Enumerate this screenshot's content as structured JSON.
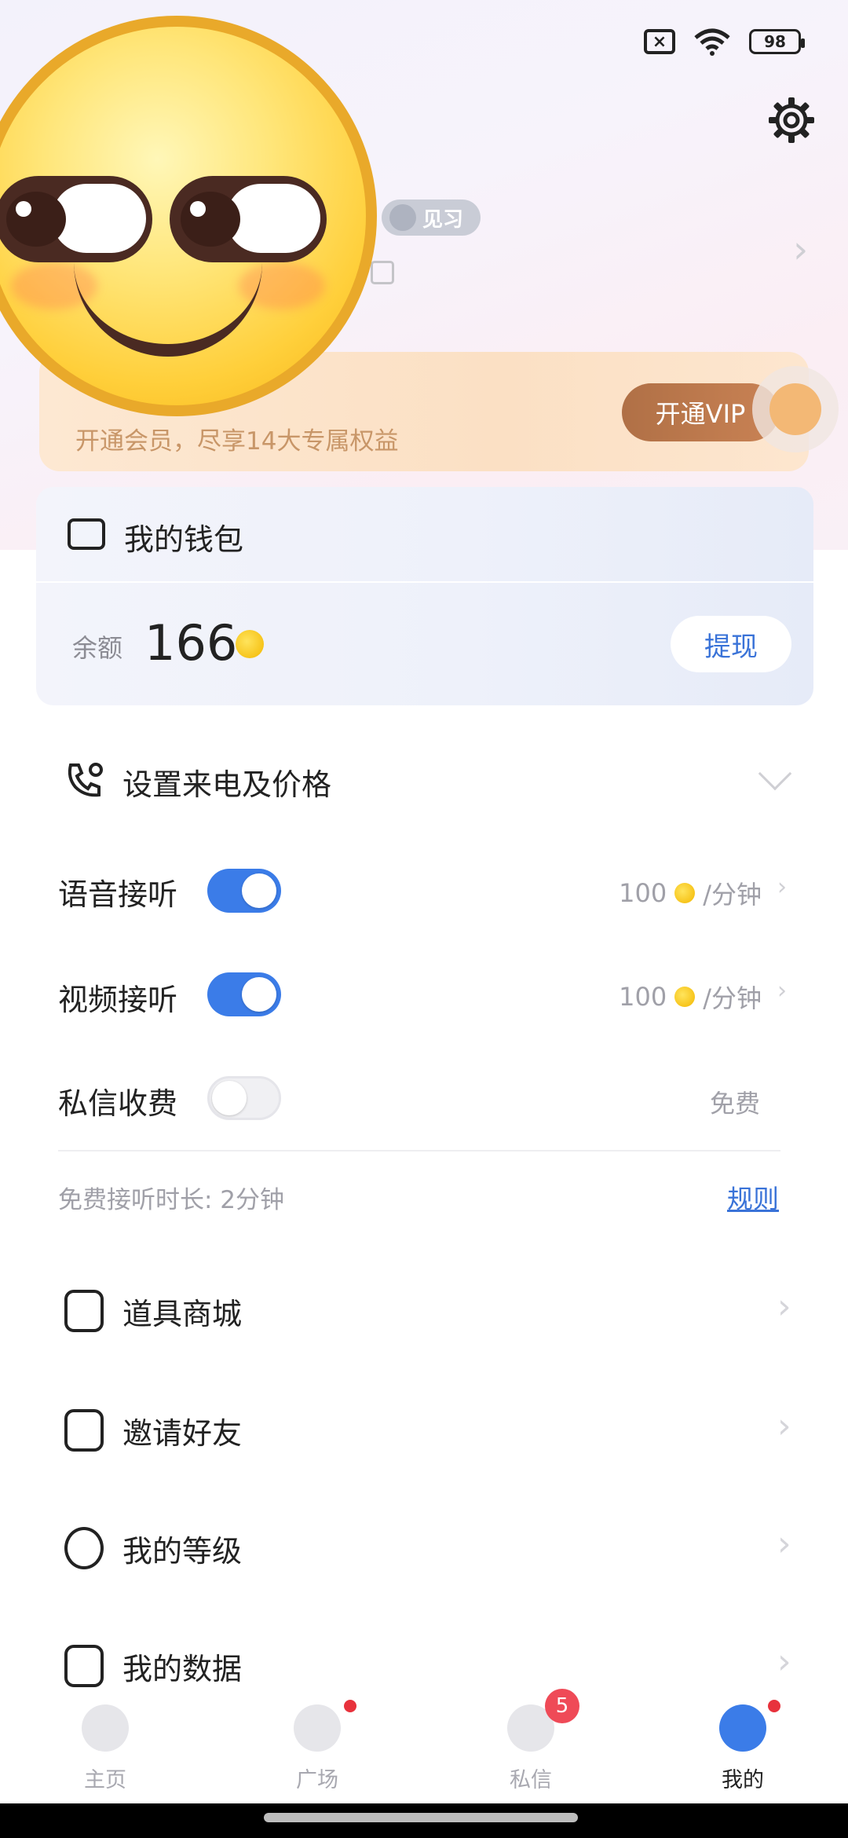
{
  "status_bar": {
    "battery": "98"
  },
  "profile": {
    "level_badge": "见习"
  },
  "vip": {
    "subtitle": "开通会员，尽享14大专属权益",
    "button": "开通VIP"
  },
  "wallet": {
    "title": "我的钱包",
    "balance_label": "余额",
    "balance": "166",
    "withdraw": "提现"
  },
  "call_settings": {
    "title": "设置来电及价格",
    "rows": [
      {
        "label": "语音接听",
        "enabled": true,
        "price": "100",
        "unit": "/分钟"
      },
      {
        "label": "视频接听",
        "enabled": true,
        "price": "100",
        "unit": "/分钟"
      },
      {
        "label": "私信收费",
        "enabled": false,
        "price": "免费"
      }
    ],
    "free_duration": "免费接听时长: 2分钟",
    "rules": "规则"
  },
  "menu": [
    {
      "label": "道具商城",
      "icon": "bag-icon"
    },
    {
      "label": "邀请好友",
      "icon": "invite-icon"
    },
    {
      "label": "我的等级",
      "icon": "level-icon"
    },
    {
      "label": "我的数据",
      "icon": "chart-icon"
    }
  ],
  "tabs": [
    {
      "label": "主页",
      "dot": false
    },
    {
      "label": "广场",
      "dot": true
    },
    {
      "label": "私信",
      "badge": "5"
    },
    {
      "label": "我的",
      "dot": true,
      "active": true
    }
  ],
  "colors": {
    "accent": "#3b7ce8",
    "vip_button": "#b97548",
    "badge_red": "#e8323c"
  }
}
